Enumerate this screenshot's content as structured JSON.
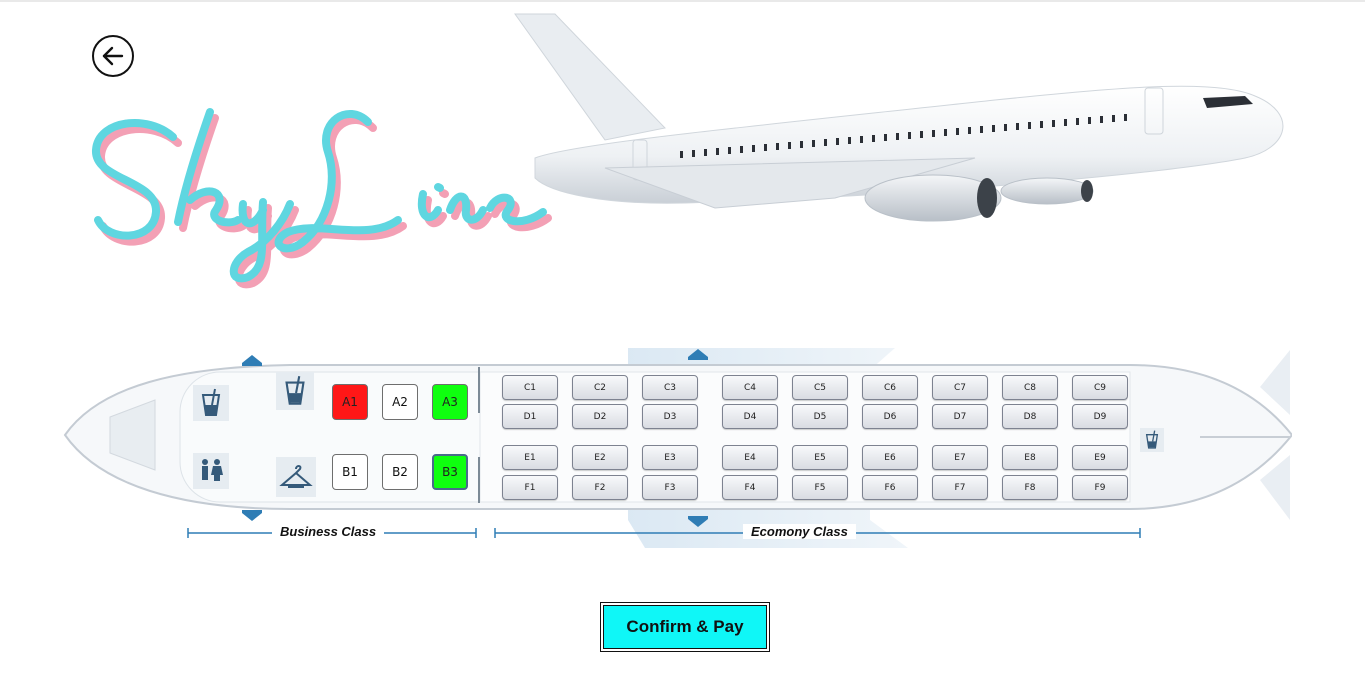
{
  "app": {
    "brand_text": "SkyLine",
    "back_icon": "arrow-left-icon",
    "colors": {
      "brand_cyan": "#5fd6e0",
      "brand_pink": "#f3a0b5",
      "booked": "#ff1717",
      "selected": "#0fff0f",
      "confirm_button": "#0ff7f7"
    }
  },
  "cabin": {
    "business_label": "Business Class",
    "economy_label": "Ecomony Class",
    "business_seats": [
      {
        "label": "A1",
        "status": "booked"
      },
      {
        "label": "A2",
        "status": "available"
      },
      {
        "label": "A3",
        "status": "selected"
      },
      {
        "label": "B1",
        "status": "available"
      },
      {
        "label": "B2",
        "status": "available"
      },
      {
        "label": "B3",
        "status": "selected"
      }
    ],
    "economy_rows": [
      [
        "C1",
        "C2",
        "C3",
        "C4",
        "C5",
        "C6",
        "C7",
        "C8",
        "C9"
      ],
      [
        "D1",
        "D2",
        "D3",
        "D4",
        "D5",
        "D6",
        "D7",
        "D8",
        "D9"
      ],
      [
        "E1",
        "E2",
        "E3",
        "E4",
        "E5",
        "E6",
        "E7",
        "E8",
        "E9"
      ],
      [
        "F1",
        "F2",
        "F3",
        "F4",
        "F5",
        "F6",
        "F7",
        "F8",
        "F9"
      ]
    ],
    "facility_icons": [
      "drink-icon",
      "restroom-icon",
      "wardrobe-icon",
      "exit-arrow-icon"
    ]
  },
  "actions": {
    "confirm_label": "Confirm & Pay"
  }
}
